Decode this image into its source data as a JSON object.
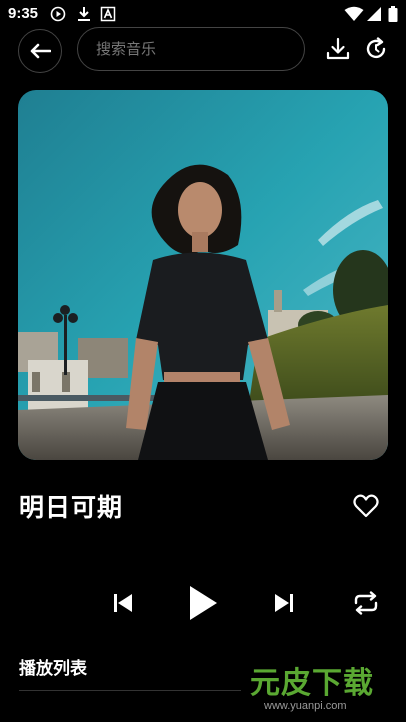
{
  "status_bar": {
    "time": "9:35",
    "icons": [
      "play-circle-icon",
      "download-icon",
      "a-box-icon",
      "wifi-icon",
      "signal-icon",
      "battery-icon"
    ]
  },
  "top_bar": {
    "back_icon": "arrow-left-icon",
    "search_placeholder": "搜索音乐",
    "search_value": "",
    "download_icon": "download-icon",
    "refresh_icon": "refresh-icon"
  },
  "now_playing": {
    "cover_alt": "album cover photo",
    "title": "明日可期",
    "favorite_icon": "heart-outline-icon"
  },
  "controls": {
    "previous_icon": "skip-previous-icon",
    "play_icon": "play-icon",
    "next_icon": "skip-next-icon",
    "repeat_icon": "repeat-icon"
  },
  "playlist": {
    "title": "播放列表"
  },
  "watermark": {
    "main": "元皮下载",
    "url": "www.yuanpi.com"
  },
  "colors": {
    "background": "#000000",
    "border": "#444444",
    "watermark_green": "#5aa832"
  }
}
